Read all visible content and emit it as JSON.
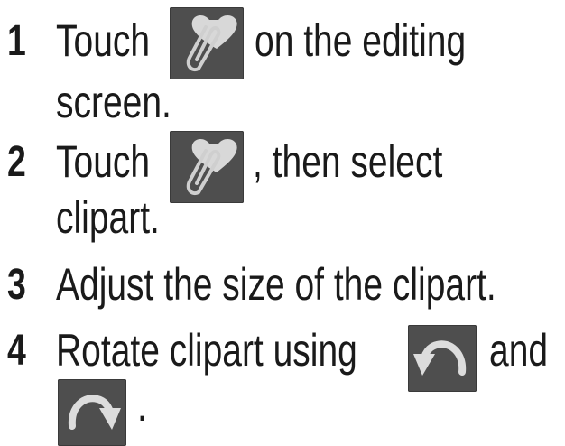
{
  "steps": [
    {
      "number": "1",
      "text_a": "Touch",
      "text_b": "on the editing",
      "text_c": "screen.",
      "icon": "clipart-paperclip-heart-icon"
    },
    {
      "number": "2",
      "text_a": "Touch",
      "text_b": ", then select",
      "text_c": "clipart.",
      "icon": "clipart-paperclip-heart-icon"
    },
    {
      "number": "3",
      "text_a": "Adjust the size of the clipart."
    },
    {
      "number": "4",
      "text_a": "Rotate clipart using",
      "text_b": "and",
      "text_c": ".",
      "icons": [
        "rotate-left-icon",
        "rotate-right-icon"
      ]
    }
  ],
  "colors": {
    "text": "#1a1a1a",
    "icon_bg": "#4e4e4e",
    "icon_fg": "#dcdcdc"
  }
}
